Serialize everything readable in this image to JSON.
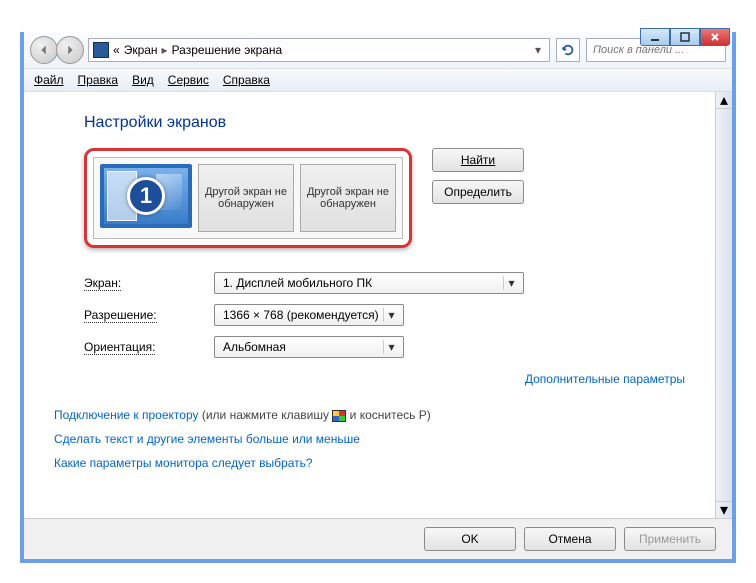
{
  "titlebar": {
    "minimize": "_",
    "maximize": "□",
    "close": "×"
  },
  "breadcrumb": {
    "prefix": "«",
    "item1": "Экран",
    "item2": "Разрешение экрана"
  },
  "search": {
    "placeholder": "Поиск в панели ..."
  },
  "menu": {
    "file": "Файл",
    "edit": "Правка",
    "view": "Вид",
    "tools": "Сервис",
    "help": "Справка"
  },
  "heading": "Настройки экранов",
  "monitors": {
    "primary_number": "1",
    "other1": "Другой экран не обнаружен",
    "other2": "Другой экран не обнаружен"
  },
  "buttons": {
    "find": "Найти",
    "detect": "Определить"
  },
  "labels": {
    "screen": "Экран:",
    "resolution": "Разрешение:",
    "orientation": "Ориентация:"
  },
  "values": {
    "screen": "1. Дисплей мобильного ПК",
    "resolution": "1366 × 768 (рекомендуется)",
    "orientation": "Альбомная"
  },
  "links": {
    "advanced": "Дополнительные параметры",
    "projector_pre": "Подключение к проектору",
    "projector_post_a": " (или нажмите клавишу ",
    "projector_post_b": " и коснитесь P)",
    "text_size": "Сделать текст и другие элементы больше или меньше",
    "which_params": "Какие параметры монитора следует выбрать?"
  },
  "footer": {
    "ok": "OK",
    "cancel": "Отмена",
    "apply": "Применить"
  }
}
